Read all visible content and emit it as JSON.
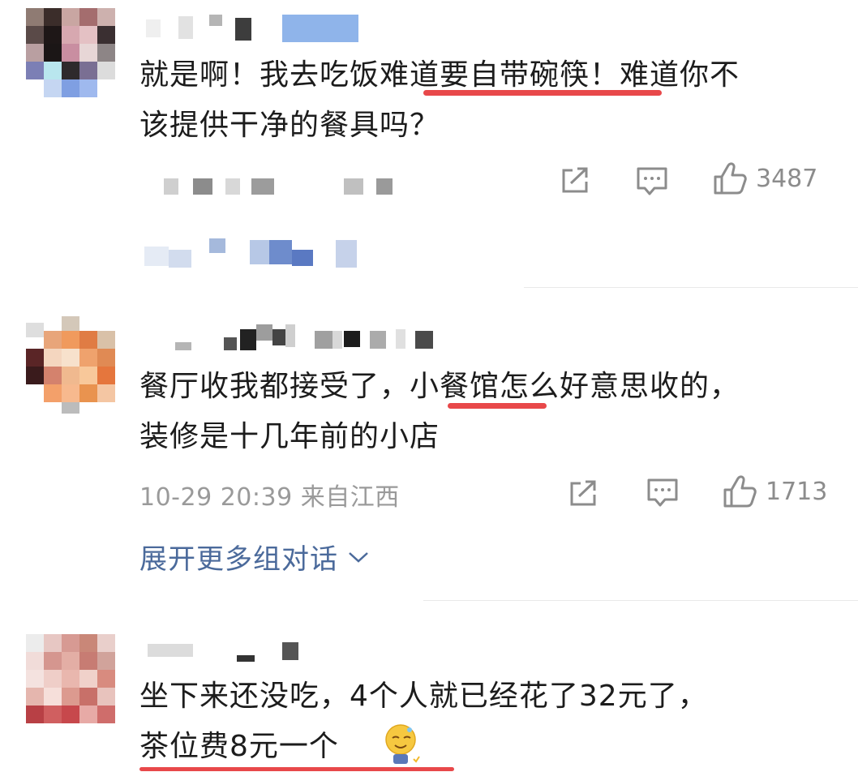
{
  "comments": [
    {
      "line1": "就是啊！我去吃饭难道要自带碗筷！难道你不",
      "line2": "该提供干净的餐具吗？",
      "likes": "3487"
    },
    {
      "line1": "餐厅收我都接受了，小餐馆怎么好意思收的，",
      "line2": "装修是十几年前的小店",
      "timestamp": "10-29 20:39 来自江西",
      "likes": "1713"
    },
    {
      "line1": "坐下来还没吃，4个人就已经花了32元了，",
      "line2": "茶位费8元一个"
    }
  ],
  "expand_label": "展开更多组对话",
  "icons": {
    "share": "share-icon",
    "comment": "comment-icon",
    "like": "thumbs-up-icon",
    "expand": "chevron-down-icon",
    "emoji": "embarrassed-smile-emoji"
  },
  "colors": {
    "highlight_underline": "#e8484a",
    "link_blue": "#4b6a9b",
    "meta_gray": "#9a9a9a"
  }
}
